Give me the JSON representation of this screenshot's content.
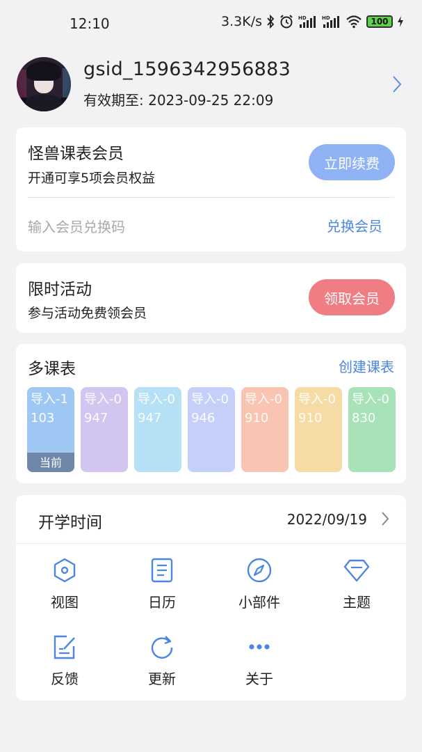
{
  "status_bar": {
    "time": "12:10",
    "net_speed": "3.3K/s",
    "battery": "100",
    "icons": [
      "bluetooth-icon",
      "alarm-icon",
      "hd-signal-icon",
      "hd-signal-icon",
      "wifi-icon",
      "battery-icon",
      "charging-icon"
    ]
  },
  "profile": {
    "username": "gsid_1596342956883",
    "expiry": "有效期至: 2023-09-25 22:09"
  },
  "membership": {
    "title": "怪兽课表会员",
    "subtitle": "开通可享5项会员权益",
    "renew_label": "立即续费",
    "redeem_placeholder": "输入会员兑换码",
    "redeem_label": "兑换会员"
  },
  "activity": {
    "title": "限时活动",
    "subtitle": "参与活动免费领会员",
    "claim_label": "领取会员"
  },
  "schedules": {
    "title": "多课表",
    "create_label": "创建课表",
    "current_label": "当前",
    "items": [
      {
        "label": "导入-1103",
        "color": "#9ec8f3"
      },
      {
        "label": "导入-0947",
        "color": "#d2c6f1"
      },
      {
        "label": "导入-0947",
        "color": "#b5e0f6"
      },
      {
        "label": "导入-0946",
        "color": "#c4cffa"
      },
      {
        "label": "导入-0910",
        "color": "#f9c5b2"
      },
      {
        "label": "导入-0910",
        "color": "#f6dba4"
      },
      {
        "label": "导入-0830",
        "color": "#a8e2b8"
      }
    ]
  },
  "settings": {
    "start_label": "开学时间",
    "start_value": "2022/09/19",
    "menu": [
      {
        "label": "视图",
        "icon": "hexagon-icon"
      },
      {
        "label": "日历",
        "icon": "calendar-icon"
      },
      {
        "label": "小部件",
        "icon": "compass-icon"
      },
      {
        "label": "主题",
        "icon": "diamond-icon"
      },
      {
        "label": "反馈",
        "icon": "edit-icon"
      },
      {
        "label": "更新",
        "icon": "refresh-icon"
      },
      {
        "label": "关于",
        "icon": "more-icon"
      }
    ]
  },
  "colors": {
    "accent": "#4c86e0",
    "renew_button": "#8fb2f5",
    "claim_button": "#f07c84"
  }
}
